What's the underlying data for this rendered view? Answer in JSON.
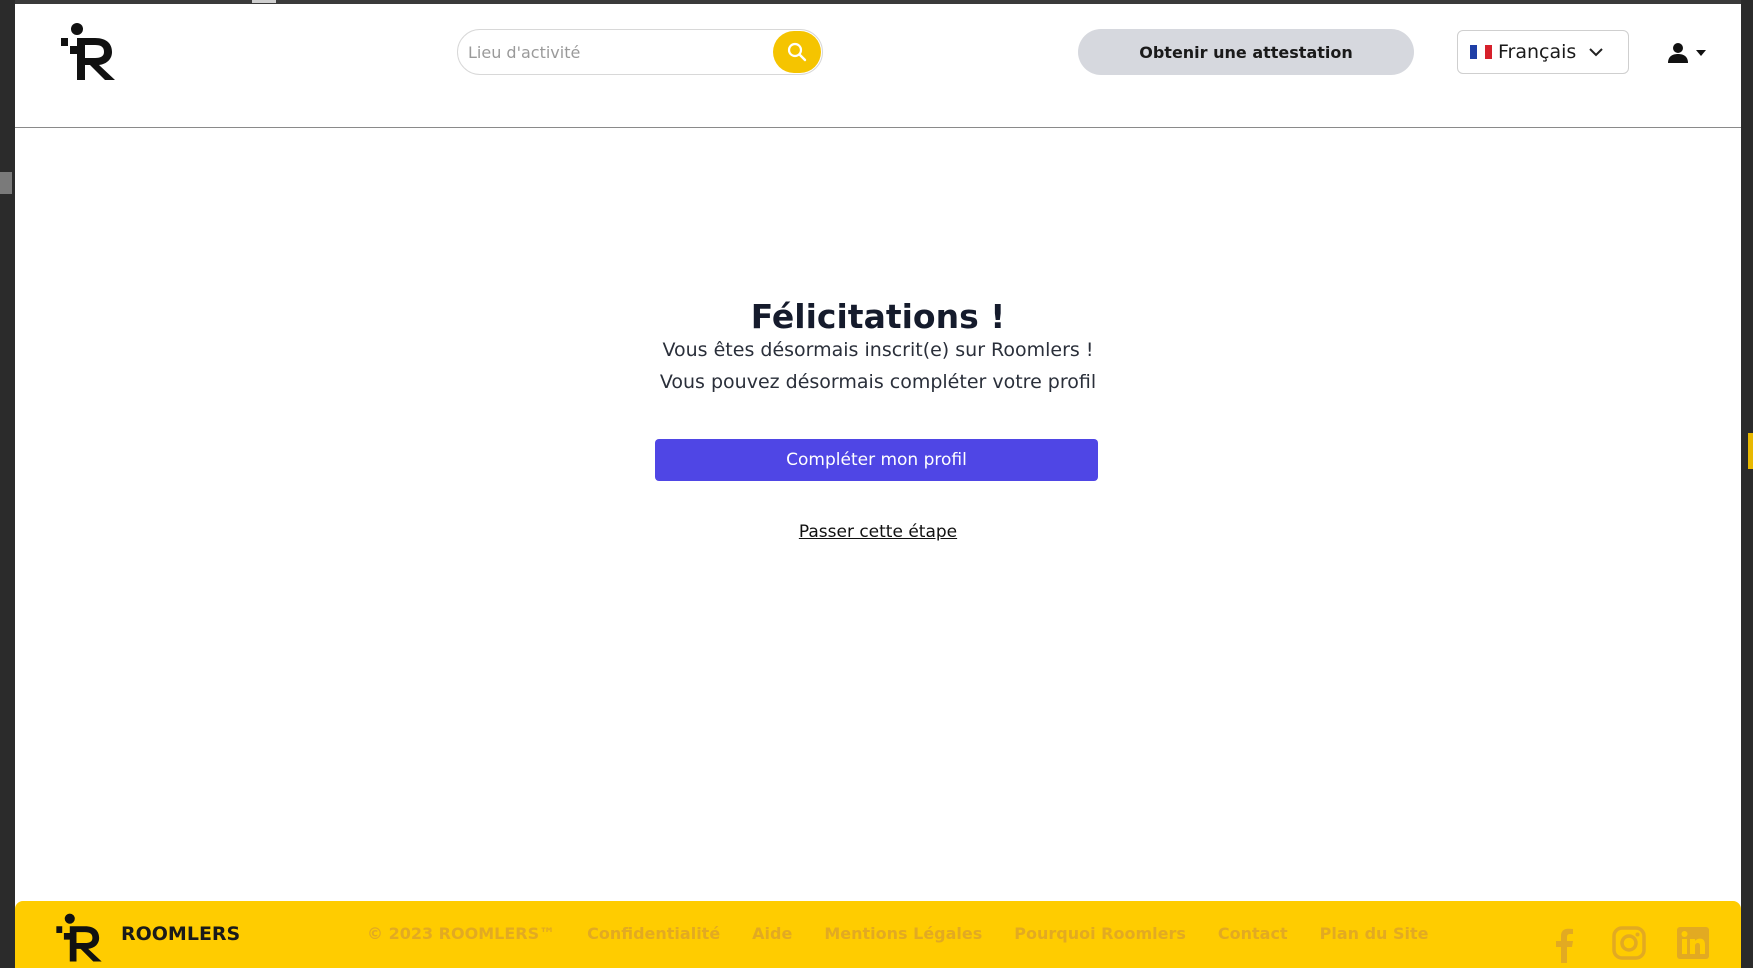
{
  "header": {
    "search": {
      "placeholder": "Lieu d'activité"
    },
    "attest_label": "Obtenir une attestation",
    "language": {
      "selected": "Français"
    }
  },
  "main": {
    "title": "Félicitations !",
    "line1": "Vous êtes désormais inscrit(e) sur Roomlers !",
    "line2": "Vous pouvez désormais compléter votre profil",
    "primary_button": "Compléter mon profil",
    "skip_link": "Passer cette étape"
  },
  "footer": {
    "brand": "ROOMLERS",
    "copyright": "© 2023 ROOMLERS™",
    "links": [
      "Confidentialité",
      "Aide",
      "Mentions Légales",
      "Pourquoi Roomlers",
      "Contact",
      "Plan du Site"
    ]
  },
  "colors": {
    "accent_yellow": "#ffcc00",
    "primary_button": "#4f46e5",
    "footer_link": "#e2aa22",
    "attest_button_bg": "#d6d8de"
  },
  "icons": [
    "logo-icon",
    "search-icon",
    "france-flag-icon",
    "chevron-down-icon",
    "user-icon",
    "caret-down-icon",
    "facebook-icon",
    "instagram-icon",
    "linkedin-icon"
  ]
}
